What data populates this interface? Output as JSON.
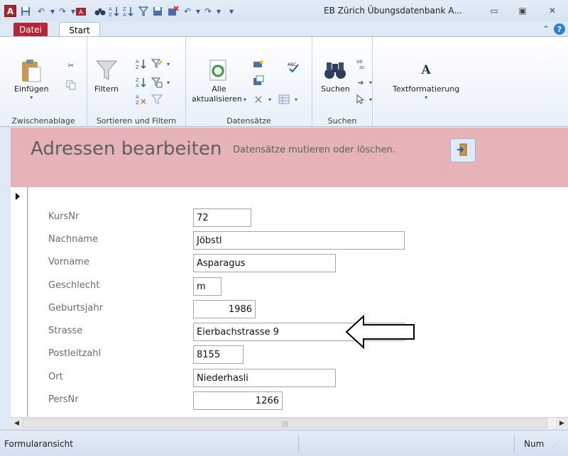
{
  "titlebar": {
    "title": "EB Zürich Übungsdatenbank A...",
    "app_icon_letter": "A"
  },
  "tabs": {
    "datei": "Datei",
    "start": "Start"
  },
  "ribbon": {
    "groups": {
      "clipboard": "Zwischenablage",
      "sort_filter": "Sortieren und Filtern",
      "records": "Datensätze",
      "find": "Suchen"
    },
    "buttons": {
      "paste": "Einfügen",
      "filter": "Filtern",
      "refresh_line1": "Alle",
      "refresh_line2": "aktualisieren",
      "find": "Suchen",
      "text_format": "Textformatierung",
      "text_format_icon_letter": "A"
    }
  },
  "form": {
    "title": "Adressen bearbeiten",
    "subtitle": "Datensätze mutieren oder löschen.",
    "fields": [
      {
        "label": "KursNr",
        "value": "72"
      },
      {
        "label": "Nachname",
        "value": "Jöbstl"
      },
      {
        "label": "Vorname",
        "value": "Asparagus"
      },
      {
        "label": "Geschlecht",
        "value": "m"
      },
      {
        "label": "Geburtsjahr",
        "value": "1986"
      },
      {
        "label": "Strasse",
        "value": "Eierbachstrasse 9"
      },
      {
        "label": "Postleitzahl",
        "value": "8155"
      },
      {
        "label": "Ort",
        "value": "Niederhasli"
      },
      {
        "label": "PersNr",
        "value": "1266"
      }
    ]
  },
  "statusbar": {
    "left": "Formularansicht",
    "right": "Num"
  }
}
